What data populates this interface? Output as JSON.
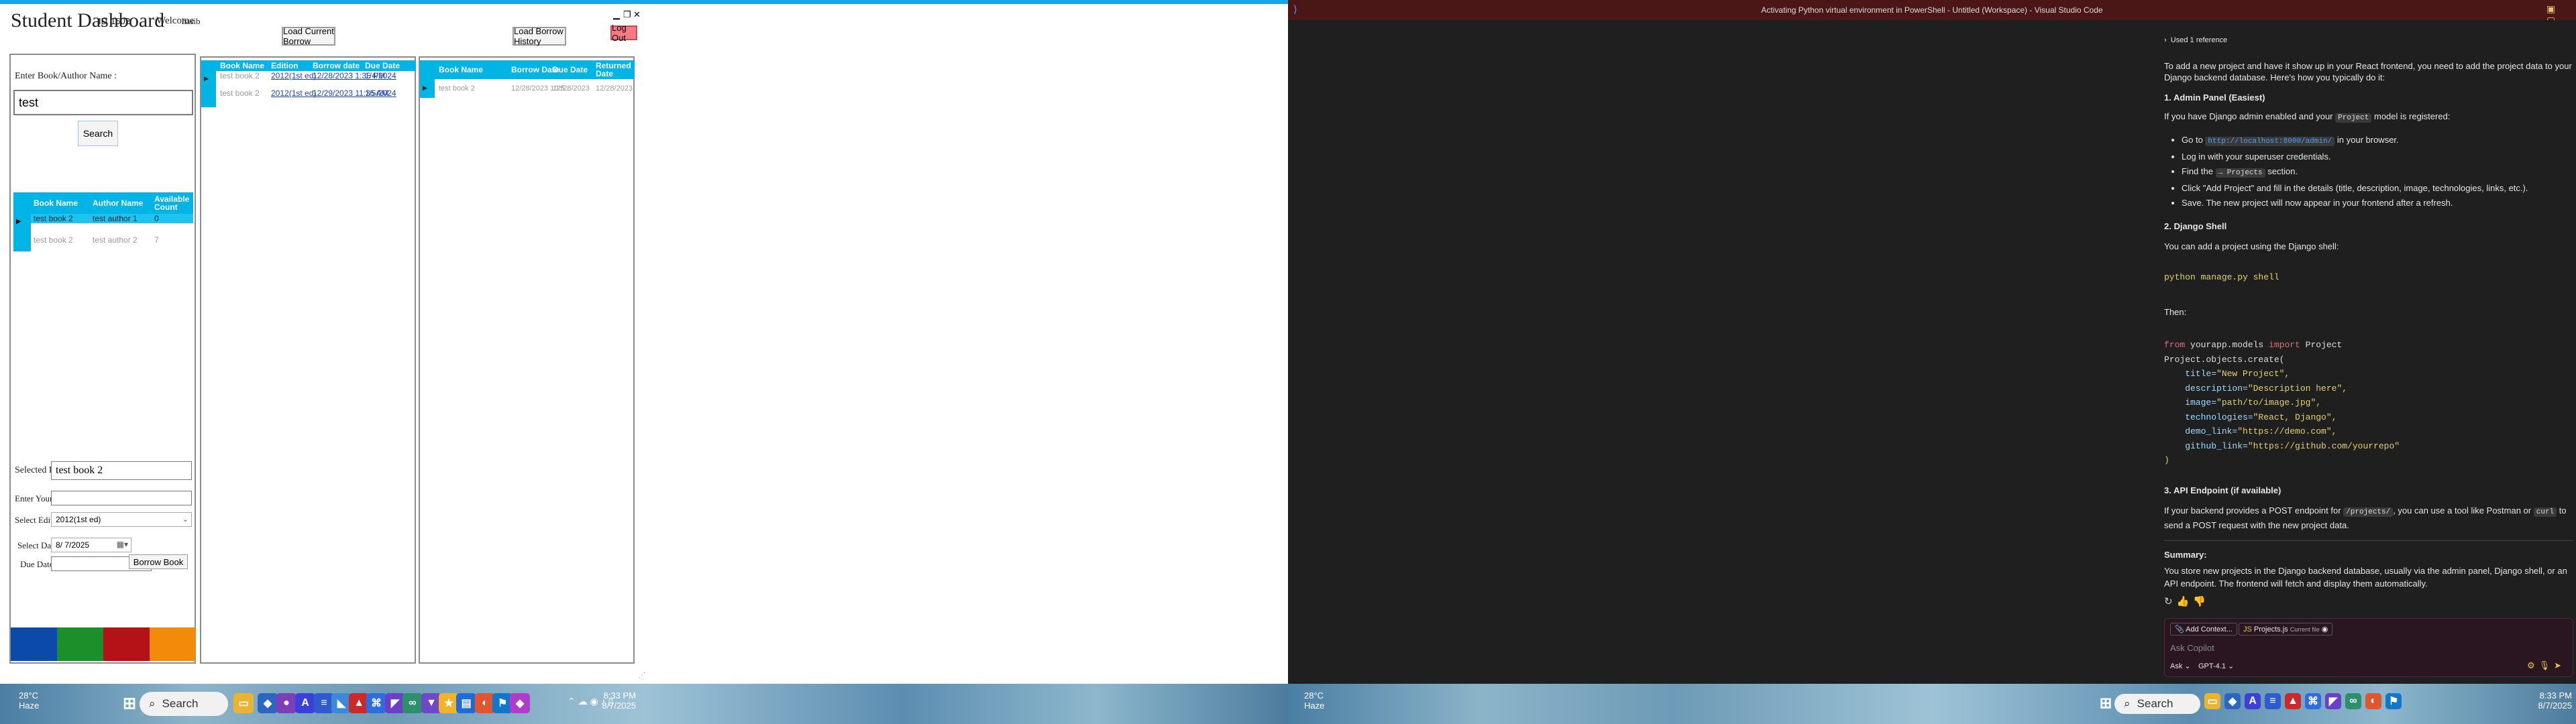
{
  "left": {
    "app": {
      "title": "Student Dashboard",
      "id_label": "ID :",
      "id_value": "1602",
      "welcome_label": "Welcome",
      "welcome_user": "hasib",
      "load_current_borrow": "Load Current Borrow",
      "load_borrow_history": "Load  Borrow History",
      "logout": "Log Out",
      "window_min": "▁",
      "window_max": "❐",
      "window_close": "✕",
      "search_label": "Enter Book/Author Name :",
      "search_value": "test",
      "search_button": "Search",
      "books_grid": {
        "headers": [
          "Book Name",
          "Author Name",
          "Available Count"
        ],
        "rows": [
          [
            "test book 2",
            "test author 1",
            "0"
          ],
          [
            "test book 2",
            "test author 2",
            "7"
          ]
        ]
      },
      "selected_book_label": "Selected Book :",
      "selected_book_value": "test book 2",
      "enter_id_label": "Enter Your ID :",
      "enter_id_value": "",
      "select_edition_label": "Select Edition :",
      "select_edition_value": "2012(1st ed)",
      "select_date_label": "Select Date :",
      "select_date_value": "8/  7/2025",
      "due_date_label": "Due Date :",
      "due_date_value": "",
      "borrow_button": "Borrow Book",
      "current_grid": {
        "headers": [
          "Book Name",
          "Edition",
          "Borrow date",
          "Due Date"
        ],
        "rows": [
          [
            "test book 2",
            "2012(1st ed)",
            "12/28/2023 1:35 PM",
            "1/4/2024"
          ],
          [
            "test book 2",
            "2012(1st ed)",
            "12/29/2023 11:35 AM",
            "1/5/2024"
          ]
        ]
      },
      "history_grid": {
        "headers": [
          "Book Name",
          "Borrow Date",
          "Due Date",
          "Returned Date"
        ],
        "rows": [
          [
            "test book 2",
            "12/28/2023 10:5...",
            "12/28/2023",
            "12/28/2023"
          ]
        ]
      },
      "color_bar": [
        "#0b4aa8",
        "#1a8f2a",
        "#b51218",
        "#f48a0a"
      ]
    },
    "taskbar": {
      "weather_temp": "28°C",
      "weather_desc": "Haze",
      "search_placeholder": "Search",
      "time": "8:33 PM",
      "date": "8/7/2025"
    }
  },
  "right": {
    "titlebar": {
      "title": "Activating Python virtual environment in PowerShell - Untitled (Workspace) - Visual Studio Code"
    },
    "chat": {
      "references": "Used 1 reference",
      "intro": "To add a new project and have it show up in your React frontend, you need to add the project data to your Django backend database. Here's how you typically do it:",
      "h1": "1. Admin Panel (Easiest)",
      "p1_a": "If you have Django admin enabled and your",
      "p1_code": "Project",
      "p1_b": "model is registered:",
      "b1_a": "Go to",
      "b1_code": "http://localhost:8000/admin/",
      "b1_b": "in your browser.",
      "b2": "Log in with your superuser credentials.",
      "b3_a": "Find the",
      "b3_code": "→ Projects",
      "b3_b": "section.",
      "b4": "Click \"Add Project\" and fill in the details (title, description, image, technologies, links, etc.).",
      "b5": "Save. The new project will now appear in your frontend after a refresh.",
      "h2": "2. Django Shell",
      "p2": "You can add a project using the Django shell:",
      "shell_cmd": "python manage.py shell",
      "then": "Then:",
      "code": {
        "l1_kw1": "from",
        "l1_mod": " yourapp.models ",
        "l1_kw2": "import",
        "l1_cls": " Project",
        "l2": "Project.objects.create(",
        "l3_k": "    title=",
        "l3_v": "\"New Project\",",
        "l4_k": "    description=",
        "l4_v": "\"Description here\",",
        "l5_k": "    image=",
        "l5_v": "\"path/to/image.jpg\",",
        "l6_k": "    technologies=",
        "l6_v": "\"React, Django\",",
        "l7_k": "    demo_link=",
        "l7_v": "\"https://demo.com\",",
        "l8_k": "    github_link=",
        "l8_v": "\"https://github.com/yourrepo\"",
        "l9": ")"
      },
      "h3": "3. API Endpoint (if available)",
      "p3_a": "If your backend provides a POST endpoint for",
      "p3_code1": "/projects/",
      "p3_b": ", you can use a tool like Postman or",
      "p3_code2": "curl",
      "p3_c": "to send a POST request with the new project data.",
      "summary_h": "Summary:",
      "summary": "You store new projects in the Django backend database, usually via the admin panel, Django shell, or an API endpoint. The frontend will fetch and display them automatically.",
      "add_context": "Add Context...",
      "file_chip": "Projects.js",
      "file_chip_sub": "Current file",
      "ask_placeholder": "Ask Copilot",
      "mode": "Ask",
      "model": "GPT-4.1"
    },
    "taskbar": {
      "weather_temp": "28°C",
      "weather_desc": "Haze",
      "search_placeholder": "Search",
      "time": "8:33 PM",
      "date": "8/7/2025"
    }
  }
}
